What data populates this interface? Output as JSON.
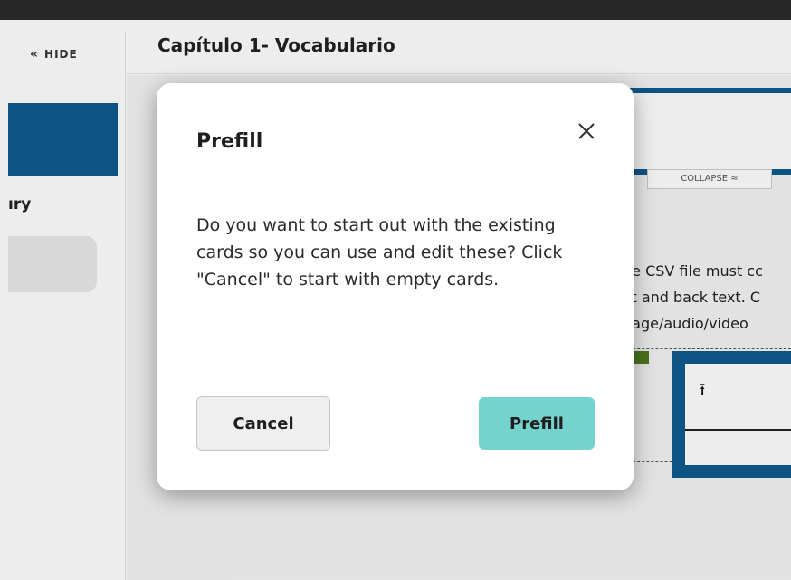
{
  "sidebar": {
    "hide_label": "HIDE",
    "section_label": "ıry"
  },
  "header": {
    "title": "Capítulo 1- Vocabulario"
  },
  "background": {
    "collapse_label": "COLLAPSE ≈",
    "csv_lines": [
      "he CSV file must cc",
      "xt and back text. C",
      "nage/audio/video"
    ]
  },
  "modal": {
    "title": "Prefill",
    "close_icon": "close-icon",
    "body": "Do you want to start out with the existing cards so you can use and edit these? Click \"Cancel\" to start with empty cards.",
    "cancel_label": "Cancel",
    "prefill_label": "Prefill"
  },
  "colors": {
    "primary_blue": "#0f5a8e",
    "prefill_teal": "#75d3cd",
    "topbar": "#2b2b2b"
  }
}
